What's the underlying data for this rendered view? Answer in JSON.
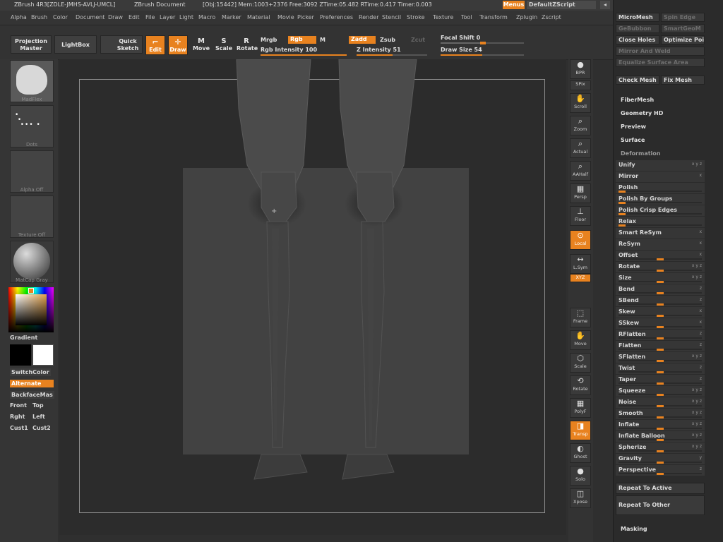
{
  "titlebar": {
    "app": "ZBrush 4R3[ZDLE-JMHS-AVLJ-UMCL]",
    "doc": "ZBrush Document",
    "stats": "[Obj:15442] Mem:1003+2376 Free:3092 ZTime:05.482 RTime:0.417 Timer:0.003",
    "menus_btn": "Menus",
    "script_btn": "DefaultZScript"
  },
  "menubar": [
    "Alpha",
    "Brush",
    "Color",
    "Document",
    "Draw",
    "Edit",
    "File",
    "Layer",
    "Light",
    "Macro",
    "Marker",
    "Material",
    "Movie",
    "Picker",
    "Preferences",
    "Render",
    "Stencil",
    "Stroke",
    "Texture",
    "Tool",
    "Transform",
    "Zplugin",
    "Zscript"
  ],
  "toolbar": {
    "projection_master": "Projection Master",
    "lightbox": "LightBox",
    "quick_sketch": "Quick Sketch",
    "edit": "Edit",
    "draw": "Draw",
    "move": "Move",
    "scale": "Scale",
    "rotate": "Rotate",
    "mrgb": "Mrgb",
    "rgb": "Rgb",
    "m": "M",
    "rgb_intensity": "Rgb Intensity 100",
    "zadd": "Zadd",
    "zsub": "Zsub",
    "zcut": "Zcut",
    "z_intensity": "Z Intensity 51",
    "focal_shift": "Focal Shift 0",
    "draw_size": "Draw Size 54",
    "rgb_intensity_value": 100,
    "z_intensity_value": 51,
    "draw_size_value": 54
  },
  "leftpanel": {
    "thumbs": [
      "MadFlex",
      "Dots",
      "Alpha Off",
      "Texture Off",
      "MatCap Gray"
    ],
    "gradient": "Gradient",
    "switchcolor": "SwitchColor",
    "alternate": "Alternate",
    "backface": "BackfaceMas",
    "front": "Front",
    "top": "Top",
    "rght": "Rght",
    "left": "Left",
    "cust1": "Cust1",
    "cust2": "Cust2"
  },
  "rightshelf": [
    "BPR",
    "SPix",
    "Scroll",
    "Zoom",
    "Actual",
    "AAHalf",
    "Persp",
    "Floor",
    "Local",
    "L.Sym",
    "XYZ",
    "",
    "",
    "Frame",
    "Move",
    "Scale",
    "Rotate",
    "PolyF",
    "Transp",
    "Ghost",
    "Solo",
    "Xpose"
  ],
  "tray": {
    "top_buttons": [
      {
        "label": "MicroMesh",
        "dim": false
      },
      {
        "label": "Spin Edge",
        "dim": true
      },
      {
        "label": "GeBubbon",
        "dim": true
      },
      {
        "label": "SmartGeoM",
        "dim": true
      },
      {
        "label": "Close Holes",
        "dim": false
      },
      {
        "label": "Optimize Poi",
        "dim": false
      },
      {
        "label": "Mirror And Weld",
        "dim": true
      },
      {
        "label": "Equalize Surface Area",
        "dim": true
      },
      {
        "label": "Check Mesh",
        "dim": false
      },
      {
        "label": "Fix Mesh",
        "dim": false
      }
    ],
    "sections": [
      "FiberMesh",
      "Geometry HD",
      "Preview",
      "Surface",
      "Deformation"
    ],
    "deformation": [
      {
        "name": "Unify",
        "ax": "x y z",
        "knob": null
      },
      {
        "name": "Mirror",
        "ax": "x",
        "knob": null
      },
      {
        "name": "Polish",
        "ax": "",
        "knob": 0
      },
      {
        "name": "Polish By Groups",
        "ax": "",
        "knob": 0
      },
      {
        "name": "Polish Crisp Edges",
        "ax": "",
        "knob": 0
      },
      {
        "name": "Relax",
        "ax": "",
        "knob": 0
      },
      {
        "name": "Smart ReSym",
        "ax": "x",
        "knob": null
      },
      {
        "name": "ReSym",
        "ax": "x",
        "knob": null
      },
      {
        "name": "Offset",
        "ax": "x",
        "knob": 0.5
      },
      {
        "name": "Rotate",
        "ax": "x y z",
        "knob": 0.5
      },
      {
        "name": "Size",
        "ax": "x y z",
        "knob": 0.5
      },
      {
        "name": "Bend",
        "ax": "z",
        "knob": 0.5
      },
      {
        "name": "SBend",
        "ax": "z",
        "knob": 0.5
      },
      {
        "name": "Skew",
        "ax": "x",
        "knob": 0.5
      },
      {
        "name": "SSkew",
        "ax": "x",
        "knob": 0.5
      },
      {
        "name": "RFlatten",
        "ax": "z",
        "knob": 0.5
      },
      {
        "name": "Flatten",
        "ax": "z",
        "knob": 0.5
      },
      {
        "name": "SFlatten",
        "ax": "x y z",
        "knob": 0.5
      },
      {
        "name": "Twist",
        "ax": "z",
        "knob": 0.5
      },
      {
        "name": "Taper",
        "ax": "z",
        "knob": 0.5
      },
      {
        "name": "Squeeze",
        "ax": "x y z",
        "knob": 0.5
      },
      {
        "name": "Noise",
        "ax": "x y z",
        "knob": 0.5
      },
      {
        "name": "Smooth",
        "ax": "x y z",
        "knob": 0.5
      },
      {
        "name": "Inflate",
        "ax": "x y z",
        "knob": 0.5
      },
      {
        "name": "Inflate Balloon",
        "ax": "x y z",
        "knob": 0.5
      },
      {
        "name": "Spherize",
        "ax": "x y z",
        "knob": 0.5
      },
      {
        "name": "Gravity",
        "ax": "y",
        "knob": 0.5
      },
      {
        "name": "Perspective",
        "ax": "z",
        "knob": 0.5
      }
    ],
    "repeat_active": "Repeat To Active",
    "repeat_other": "Repeat To Other",
    "masking": "Masking"
  }
}
